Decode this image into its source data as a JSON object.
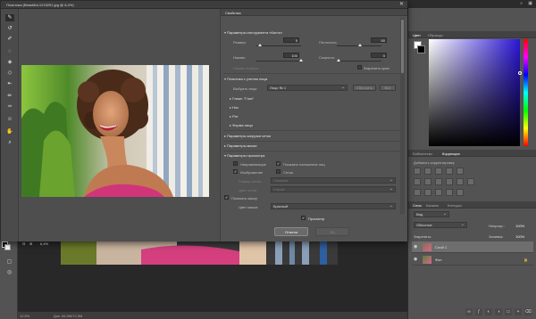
{
  "dialog": {
    "title": "Пластика (Beautiful-1215251.jpg @ 6,4%)",
    "zoom": "6,4%",
    "properties_title": "Свойства",
    "brush_section": "Параметры инструмента «Кисть»",
    "size_label": "Размер:",
    "size_value": "5",
    "density_label": "Плотность:",
    "density_value": "50",
    "pressure_label": "Нажим:",
    "pressure_value": "100",
    "rate_label": "Скорость:",
    "rate_value": "0",
    "stylus_label": "Нажим стилуса",
    "pin_edges_label": "Закрепить края",
    "face_section": "Пластика с учетом лица",
    "select_face_label": "Выбрать лицо:",
    "select_face_value": "Лицо № 1",
    "reset_label": "Сбросить",
    "all_label": "Все",
    "face_sub": [
      "Глаза: \"Глаз\"",
      "Нос",
      "Рот",
      "Форма лица"
    ],
    "load_mesh": "Параметры загрузки сетки",
    "mask_params": "Параметры маски",
    "view_params": "Параметры просмотра",
    "guides_label": "Направляющие",
    "face_overlay_label": "Показать наложение лиц",
    "image_label": "Изображение",
    "mesh_label": "Сетка",
    "mesh_size_label": "Размер сетки:",
    "mesh_size_value": "Средняя",
    "mesh_color_label": "Цвет сетки:",
    "mesh_color_value": "Серый",
    "mask_color_label": "Цвет маски:",
    "mask_color_value": "Красный",
    "show_mask_label": "Показать маску",
    "bg_color_label": "Цвет маски:",
    "bg_color_value": "Красный",
    "preview_label": "Просмотр",
    "cancel_label": "Отмена",
    "ok_label": "ОК"
  },
  "panels": {
    "color_tab": "Цвет",
    "swatches_tab": "Образцы",
    "adjust_tab": "Библиотеки",
    "corrections_tab": "Коррекция",
    "add_correction": "Добавить корректировку",
    "layers_tab": "Слои",
    "channels_tab": "Каналы",
    "paths_tab": "Контуры",
    "layer_kind": "Вид",
    "blend_mode": "Обычные",
    "opacity_label": "Непрозр.:",
    "opacity_value": "100%",
    "fill_label": "Заливка:",
    "fill_value": "100%",
    "lock_label": "Закрепить:",
    "layers": [
      {
        "name": "Слой 1"
      },
      {
        "name": "Фон"
      }
    ]
  },
  "status": {
    "zoom": "12,5%",
    "doc": "Док: 84,5M/72,5M"
  },
  "colors": {
    "accent": "#2b16d6"
  }
}
